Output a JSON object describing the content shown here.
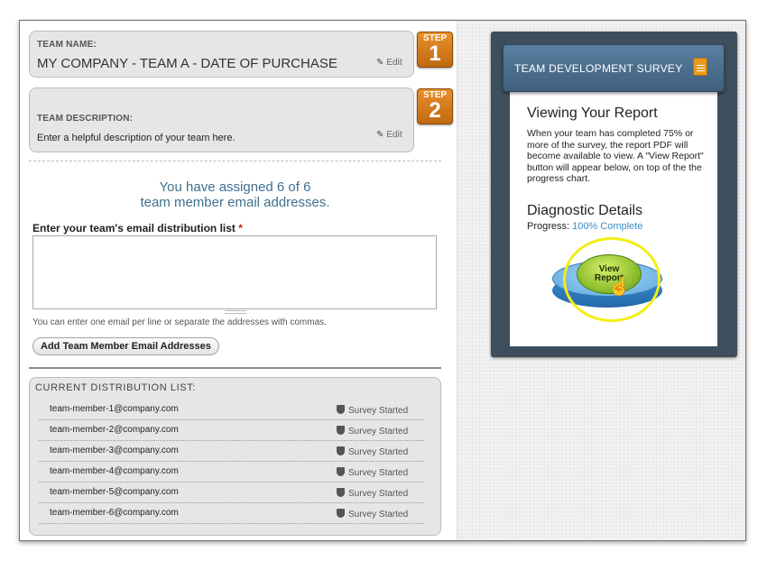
{
  "team_name": {
    "label": "TEAM NAME:",
    "value": "MY COMPANY - TEAM A - DATE OF PURCHASE",
    "edit": "Edit"
  },
  "team_description": {
    "label": "TEAM DESCRIPTION:",
    "value": "Enter a helpful description of your team here.",
    "edit": "Edit"
  },
  "steps": [
    {
      "word": "STEP",
      "number": "1"
    },
    {
      "word": "STEP",
      "number": "2"
    }
  ],
  "assigned": {
    "line1": "You have assigned 6 of 6",
    "line2": "team member email addresses."
  },
  "distribution": {
    "label": "Enter your team's email distribution list",
    "required_mark": "*",
    "textarea_value": "",
    "helper": "You can enter one email per line or separate the addresses with commas.",
    "add_button": "Add Team Member Email Addresses"
  },
  "current_list": {
    "title": "CURRENT DISTRIBUTION LIST:",
    "rows": [
      {
        "email": "team-member-1@company.com",
        "status": "Survey Started"
      },
      {
        "email": "team-member-2@company.com",
        "status": "Survey Started"
      },
      {
        "email": "team-member-3@company.com",
        "status": "Survey Started"
      },
      {
        "email": "team-member-4@company.com",
        "status": "Survey Started"
      },
      {
        "email": "team-member-5@company.com",
        "status": "Survey Started"
      },
      {
        "email": "team-member-6@company.com",
        "status": "Survey Started"
      }
    ]
  },
  "panel": {
    "header": "TEAM DEVELOPMENT SURVEY",
    "viewing_title": "Viewing Your Report",
    "viewing_body": "When your team has completed 75% or more of the survey, the report PDF will become available to view. A \"View Report\" button will appear below, on top of the the progress chart.",
    "diagnostic_title": "Diagnostic Details",
    "progress_label": "Progress:",
    "progress_value": "100% Complete",
    "view_button_line1": "View",
    "view_button_line2": "Report"
  },
  "colors": {
    "accent_blue": "#3c8cc8",
    "step_orange": "#d67a1c",
    "panel_dark": "#3d4e5c",
    "highlight_yellow": "#f2ee14"
  },
  "icons": {
    "edit": "pencil-icon",
    "status": "shield-icon",
    "document": "document-icon",
    "cursor": "hand-cursor-icon"
  }
}
